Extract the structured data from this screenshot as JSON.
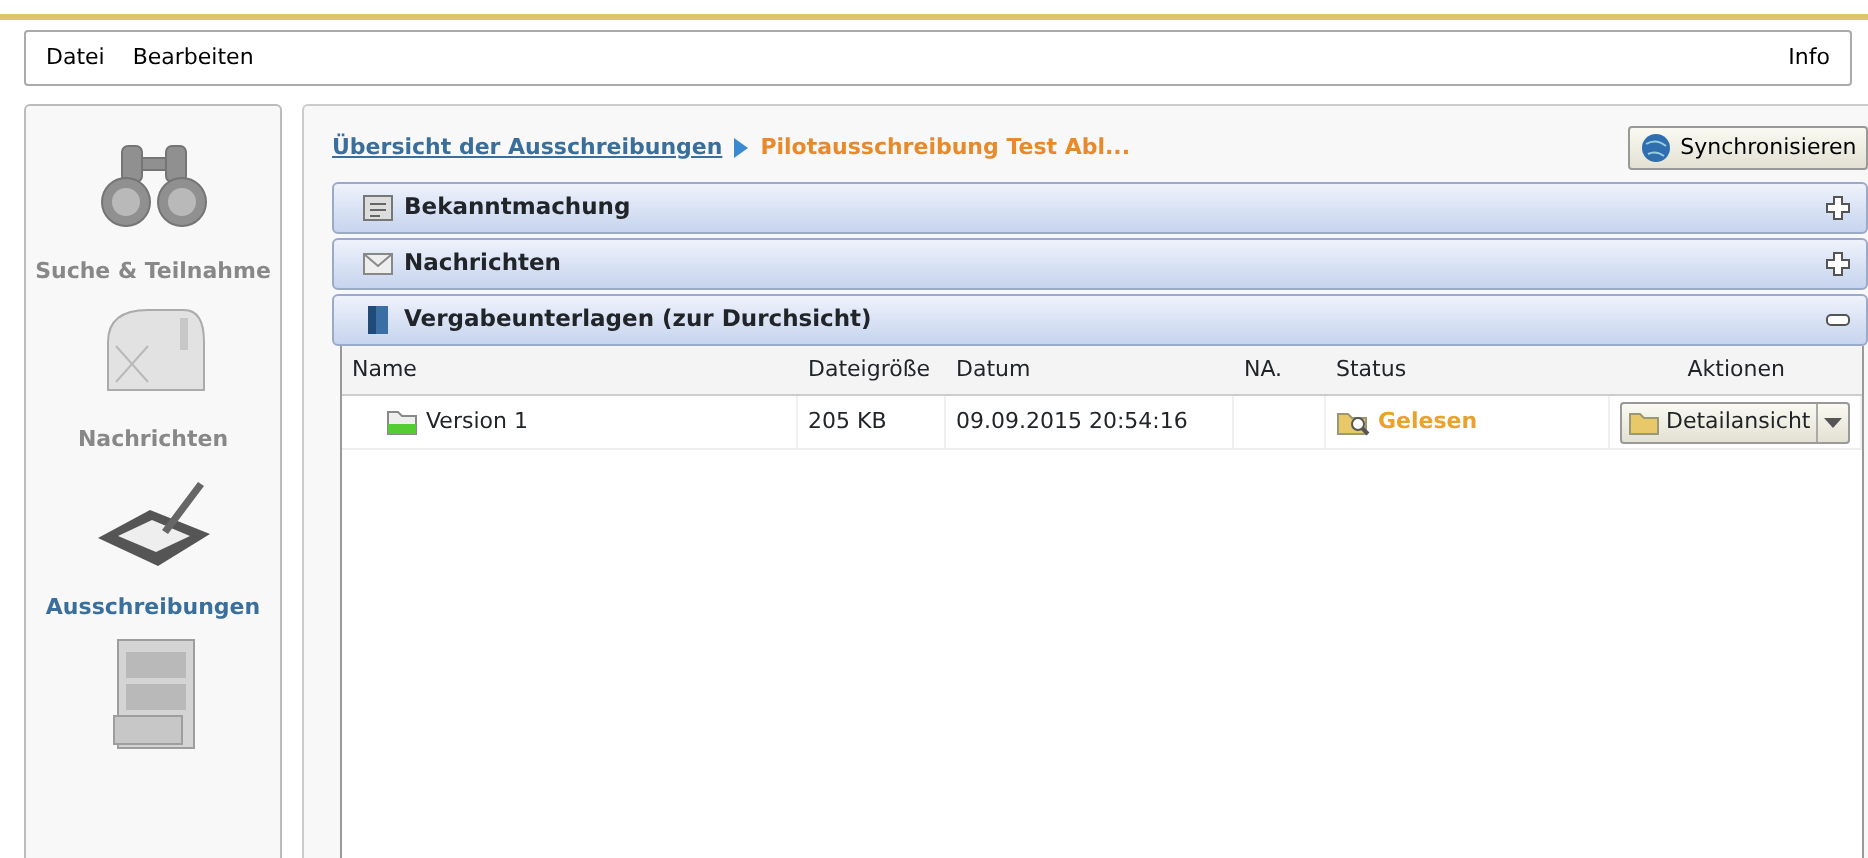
{
  "menu": {
    "left": [
      "Datei",
      "Bearbeiten"
    ],
    "right": [
      "Info"
    ]
  },
  "sidebar": {
    "items": [
      {
        "kind": "binoculars",
        "label": "Suche & Teilnahme",
        "selected": false
      },
      {
        "kind": "mailbox",
        "label": "Nachrichten",
        "selected": false
      },
      {
        "kind": "tablet",
        "label": "Ausschreibungen",
        "selected": true
      },
      {
        "kind": "cabinet",
        "selected": false
      }
    ]
  },
  "breadcrumb": {
    "link": "Übersicht der Ausschreibungen",
    "current": "Pilotausschreibung Test Abl..."
  },
  "sync_button": "Synchronisieren",
  "sections": [
    {
      "kind": "notice",
      "title": "Bekanntmachung",
      "expanded": false
    },
    {
      "kind": "mail",
      "title": "Nachrichten",
      "expanded": false
    },
    {
      "kind": "door",
      "title": "Vergabeunterlagen (zur Durchsicht)",
      "expanded": true
    }
  ],
  "table": {
    "columns": [
      "Name",
      "Dateigröße",
      "Datum",
      "NA.",
      "Status",
      "Aktionen"
    ],
    "rows": [
      {
        "name": "Version 1",
        "size": "205 KB",
        "date": "09.09.2015 20:54:16",
        "na": "",
        "status": "Gelesen",
        "action": "Detailansicht"
      }
    ]
  }
}
